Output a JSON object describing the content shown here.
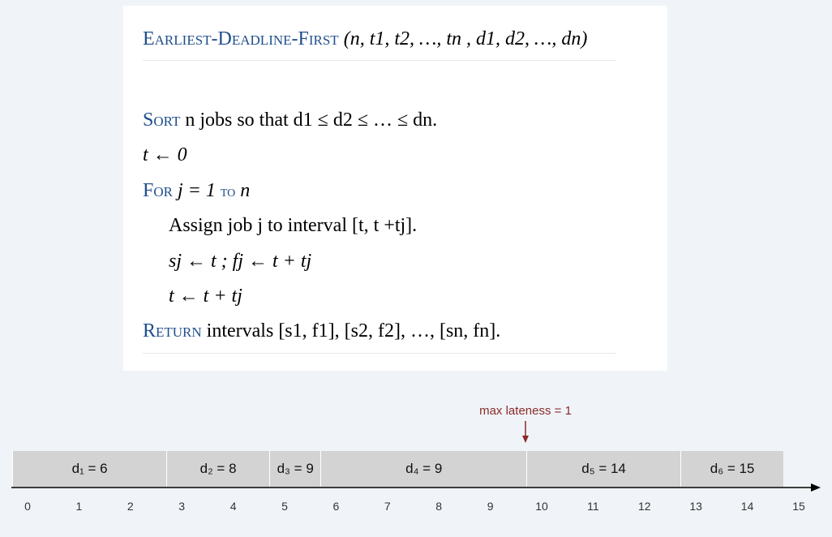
{
  "algorithm": {
    "title_keyword": "Earliest-Deadline-First",
    "title_args": " (n, t1, t2, …, tn , d1, d2, …, dn)",
    "line1_kw": "Sort",
    "line1_text": " n jobs so that d1 ≤ d2 ≤ … ≤ dn.",
    "line2": "t ← 0",
    "line3_kw1": "For",
    "line3_mid": " j = 1 ",
    "line3_kw2": "to",
    "line3_end": " n",
    "line4": "Assign job j to interval [t, t +tj].",
    "line5": "sj ← t ;  fj ← t + tj",
    "line6": "t ← t + tj",
    "line7_kw": "Return",
    "line7_text": " intervals [s1, f1], [s2, f2], …, [sn, fn]."
  },
  "schedule": {
    "jobs": [
      {
        "label": "d₁ = 6",
        "start": 0,
        "end": 3
      },
      {
        "label": "d₂ = 8",
        "start": 3,
        "end": 5
      },
      {
        "label": "d₃ = 9",
        "start": 5,
        "end": 6
      },
      {
        "label": "d₄ = 9",
        "start": 6,
        "end": 10
      },
      {
        "label": "d₅ = 14",
        "start": 10,
        "end": 13
      },
      {
        "label": "d₆ = 15",
        "start": 13,
        "end": 15
      }
    ],
    "ticks": [
      "0",
      "1",
      "2",
      "3",
      "4",
      "5",
      "6",
      "7",
      "8",
      "9",
      "10",
      "11",
      "12",
      "13",
      "14",
      "15"
    ],
    "annotation": "max lateness = 1",
    "annotation_at": 10,
    "colors": {
      "box": "#d3d3d3",
      "annotation": "#8b2a2a",
      "keyword": "#1f4e8c"
    }
  }
}
